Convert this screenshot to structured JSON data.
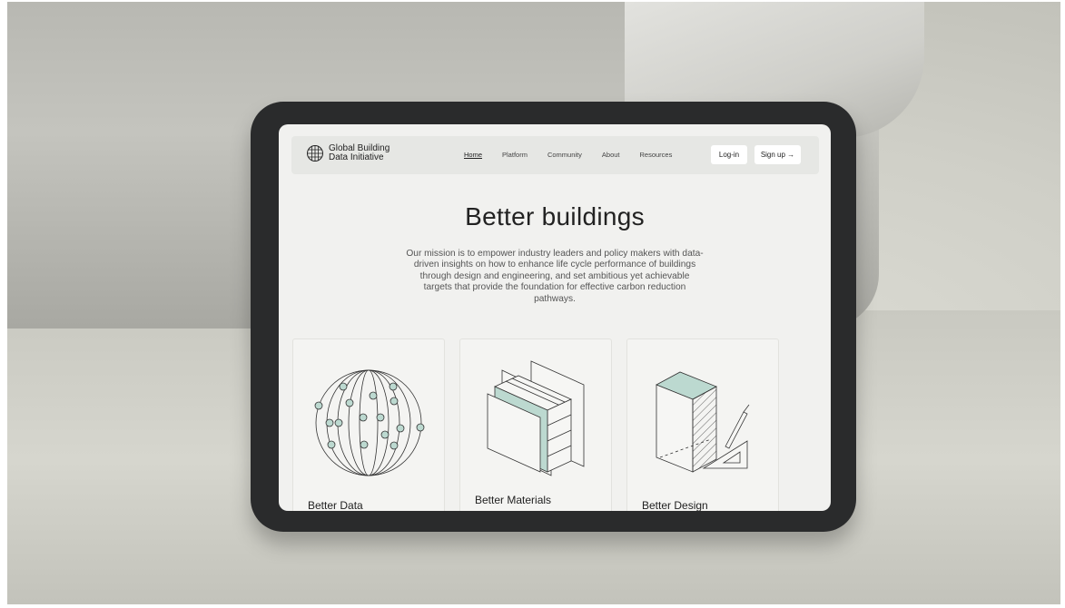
{
  "site": {
    "logo_text": "Global Building Data Initiative"
  },
  "nav": {
    "links": [
      "Home",
      "Platform",
      "Community",
      "About",
      "Resources"
    ],
    "active": "Home",
    "login_label": "Log-in",
    "signup_label": "Sign up →"
  },
  "hero": {
    "title": "Better buildings",
    "text": "Our mission is to empower industry leaders and policy makers with data-driven insights on how to enhance life cycle performance of buildings through design and engineering, and set ambitious yet achievable targets that provide the foundation for effective carbon reduction pathways."
  },
  "cards": [
    {
      "title": "Better Data",
      "icon": "globe-data-icon"
    },
    {
      "title": "Better Materials",
      "icon": "wall-materials-icon"
    },
    {
      "title": "Better Design",
      "icon": "building-design-icon"
    }
  ],
  "colors": {
    "accent": "#bcd9d0",
    "screen_bg": "#f1f1ef",
    "navbar_bg": "#e6e7e4",
    "text": "#222222"
  }
}
